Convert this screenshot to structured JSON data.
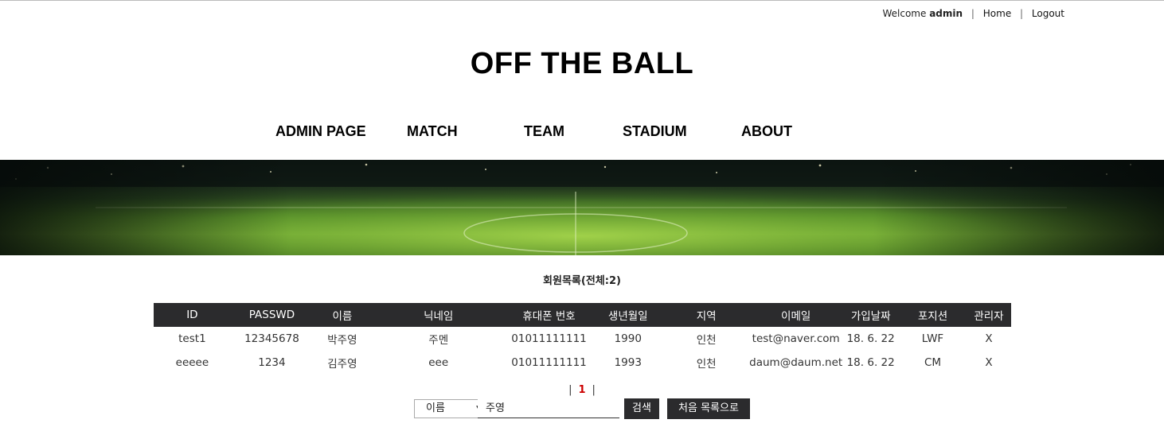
{
  "topbar": {
    "welcome_prefix": "Welcome",
    "username": "admin",
    "separator": "|",
    "home": "Home",
    "logout": "Logout"
  },
  "site": {
    "title": "OFF THE BALL"
  },
  "nav": {
    "items": [
      "ADMIN PAGE",
      "MATCH",
      "TEAM",
      "STADIUM",
      "ABOUT"
    ]
  },
  "member_list": {
    "title": "회원목록(전체:2)",
    "columns": [
      "ID",
      "PASSWD",
      "이름",
      "닉네임",
      "휴대폰 번호",
      "생년월일",
      "지역",
      "이메일",
      "가입날짜",
      "포지션",
      "관리자"
    ],
    "rows": [
      [
        "test1",
        "12345678",
        "박주영",
        "주멘",
        "01011111111",
        "1990",
        "인천",
        "test@naver.com",
        "18. 6. 22",
        "LWF",
        "X"
      ],
      [
        "eeeee",
        "1234",
        "김주영",
        "eee",
        "01011111111",
        "1993",
        "인천",
        "daum@daum.net",
        "18. 6. 22",
        "CM",
        "X"
      ]
    ]
  },
  "pagination": {
    "left_sep": "|",
    "current_page": "1",
    "right_sep": "|"
  },
  "search": {
    "field_selected": "이름",
    "query": "주영",
    "search_button": "검색",
    "reset_button": "처음 목록으로"
  }
}
